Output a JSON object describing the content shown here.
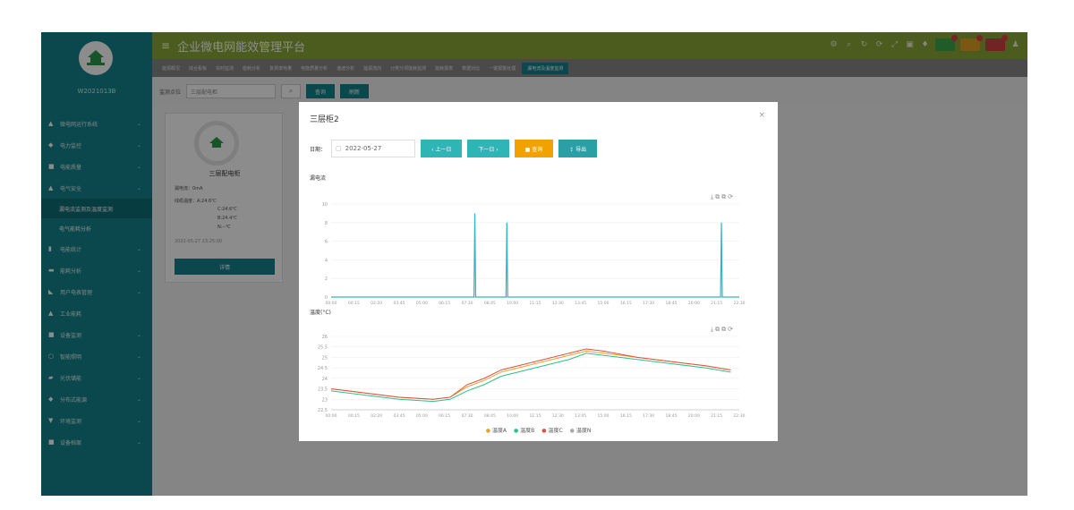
{
  "header": {
    "title": "企业微电网能效管理平台",
    "menu_icon": "menu-icon"
  },
  "sidebar": {
    "user": "W2021013B",
    "items": [
      {
        "label": "微电网运行系统",
        "icon": "building-icon",
        "chev": "⌄"
      },
      {
        "label": "电力监控",
        "icon": "monitor-icon",
        "chev": "⌄"
      },
      {
        "label": "电能质量",
        "icon": "chart-icon",
        "chev": "⌄"
      },
      {
        "label": "电气安全",
        "icon": "user-icon",
        "chev": "⌄"
      }
    ],
    "sub_items": [
      {
        "label": "漏电流监测及温度监测"
      },
      {
        "label": "电气能耗分析"
      }
    ],
    "items2": [
      {
        "label": "电能统计",
        "icon": "bars-icon",
        "chev": "⌄"
      },
      {
        "label": "能耗分析",
        "icon": "grid-icon",
        "chev": "⌄"
      },
      {
        "label": "用户电表管理",
        "icon": "meter-icon",
        "chev": "⌄"
      },
      {
        "label": "工业能耗",
        "icon": "factory-icon",
        "chev": ""
      },
      {
        "label": "设备监测",
        "icon": "device-icon",
        "chev": "⌄"
      },
      {
        "label": "智能照明",
        "icon": "bulb-icon",
        "chev": "⌄"
      },
      {
        "label": "光伏储能",
        "icon": "solar-icon",
        "chev": "⌄"
      },
      {
        "label": "分布式能源",
        "icon": "dist-icon",
        "chev": "⌄"
      },
      {
        "label": "环境监测",
        "icon": "env-icon",
        "chev": "⌄"
      },
      {
        "label": "设备档案",
        "icon": "archive-icon",
        "chev": "⌄"
      }
    ]
  },
  "tabs": [
    "能源概况",
    "综合看板",
    "实时监测",
    "能耗分析",
    "复费率电量",
    "电能质量分析",
    "谐波分析",
    "能源流向",
    "分类分项能耗监测",
    "能耗报表",
    "数据对比",
    "一键报警处理",
    "漏电流及温度监测"
  ],
  "filter": {
    "label": "监测点位",
    "value": "三层配电柜",
    "search": "⌕",
    "query_label": "查询",
    "reset_label": "刷新"
  },
  "card": {
    "name": "三层配电柜",
    "leak_label": "漏电流：",
    "leak_value": "0mA",
    "temp_label": "线缆温度：",
    "temps": [
      "A:24.6℃",
      "C:24.6℃",
      "B:24.4℃",
      "N:--℃"
    ],
    "time": "2022-05-27 23:25:00",
    "btn": "详情"
  },
  "modal": {
    "title": "三层柜2",
    "close": "×",
    "date_label": "日期：",
    "date": "2022-05-27",
    "prev": "‹ 上一日",
    "next": "下一日 ›",
    "query": "■ 查询",
    "export": "⇪ 导出",
    "leak_section": "漏电流",
    "temp_section": "温度(°C)",
    "chart_tools": "⤓⧉⧉⟳"
  },
  "chart_data": [
    {
      "type": "line",
      "title": "漏电流",
      "x_ticks": [
        "00:00",
        "00:15",
        "02:20",
        "03:45",
        "05:00",
        "06:15",
        "07:30",
        "08:45",
        "10:00",
        "11:15",
        "12:30",
        "13:45",
        "15:00",
        "16:15",
        "17:30",
        "18:45",
        "20:00",
        "21:15",
        "22:30"
      ],
      "ylim": [
        0,
        10
      ],
      "y_ticks": [
        0,
        2,
        4,
        6,
        8,
        10
      ],
      "series": [
        {
          "color": "#34b3c0",
          "spikes": [
            {
              "x": "08:27",
              "y": 9
            },
            {
              "x": "10:20",
              "y": 8
            },
            {
              "x": "22:57",
              "y": 8
            }
          ],
          "baseline": 0
        }
      ]
    },
    {
      "type": "line",
      "title": "温度(°C)",
      "x_ticks": [
        "00:00",
        "00:15",
        "02:20",
        "03:45",
        "05:00",
        "06:15",
        "07:30",
        "08:45",
        "10:00",
        "11:15",
        "12:30",
        "13:45",
        "15:00",
        "16:15",
        "17:30",
        "18:45",
        "20:00",
        "21:15",
        "22:30"
      ],
      "ylim": [
        22.5,
        26
      ],
      "y_ticks": [
        22.5,
        23,
        23.5,
        24,
        24.5,
        25,
        25.5,
        26
      ],
      "legend": [
        "温度A",
        "温度B",
        "温度C",
        "温度N"
      ],
      "colors": [
        "#f0a030",
        "#2bbf90",
        "#e0503c",
        "#aaaaaa"
      ],
      "x": [
        0,
        2,
        4,
        6,
        7,
        8,
        9,
        10,
        12,
        14,
        15,
        16,
        18,
        20,
        22,
        23.5
      ],
      "series": [
        {
          "name": "温度A",
          "values": [
            23.5,
            23.3,
            23.1,
            23.0,
            23.1,
            23.6,
            23.9,
            24.3,
            24.7,
            25.1,
            25.3,
            25.2,
            25.0,
            24.8,
            24.6,
            24.4
          ]
        },
        {
          "name": "温度B",
          "values": [
            23.4,
            23.2,
            23.0,
            22.9,
            23.0,
            23.4,
            23.7,
            24.1,
            24.5,
            24.9,
            25.2,
            25.1,
            24.9,
            24.7,
            24.5,
            24.3
          ]
        },
        {
          "name": "温度C",
          "values": [
            23.5,
            23.3,
            23.1,
            23.0,
            23.1,
            23.7,
            24.0,
            24.4,
            24.8,
            25.2,
            25.4,
            25.3,
            25.0,
            24.8,
            24.6,
            24.4
          ]
        }
      ]
    }
  ],
  "legend": [
    "温度A",
    "温度B",
    "温度C",
    "温度N"
  ]
}
